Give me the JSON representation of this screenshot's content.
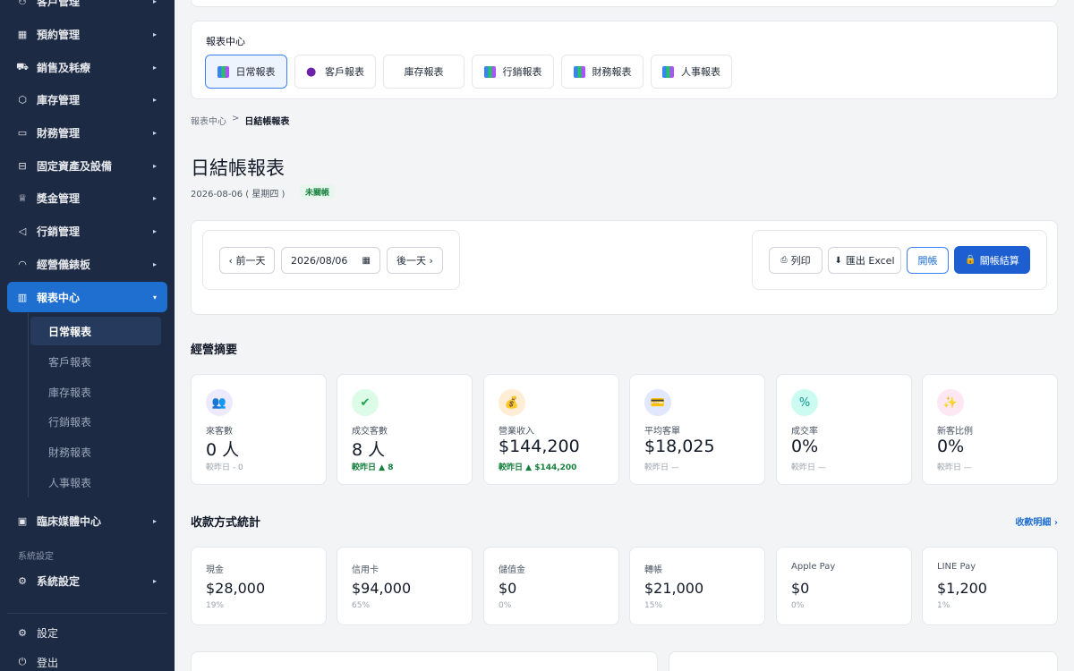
{
  "sidebar": {
    "items": [
      {
        "label": "客戶管理",
        "icon": "user-icon",
        "glyph": "⚇"
      },
      {
        "label": "預約管理",
        "icon": "calendar-icon",
        "glyph": "▦"
      },
      {
        "label": "銷售及耗療",
        "icon": "cart-icon",
        "glyph": "⛟"
      },
      {
        "label": "庫存管理",
        "icon": "box-icon",
        "glyph": "⬡"
      },
      {
        "label": "財務管理",
        "icon": "wallet-icon",
        "glyph": "▭"
      },
      {
        "label": "固定資產及設備",
        "icon": "briefcase-icon",
        "glyph": "⊟"
      },
      {
        "label": "獎金管理",
        "icon": "trophy-icon",
        "glyph": "♕"
      },
      {
        "label": "行銷管理",
        "icon": "megaphone-icon",
        "glyph": "◁"
      },
      {
        "label": "經營儀錶板",
        "icon": "gauge-icon",
        "glyph": "◠"
      },
      {
        "label": "報表中心",
        "icon": "bar-chart-icon",
        "glyph": "▥"
      }
    ],
    "sub_items": [
      "日常報表",
      "客戶報表",
      "庫存報表",
      "行銷報表",
      "財務報表",
      "人事報表"
    ],
    "media": {
      "label": "臨床媒體中心",
      "icon": "image-icon",
      "glyph": "▣"
    },
    "system_section": "系統設定",
    "system": {
      "label": "系統設定",
      "icon": "gear-icon",
      "glyph": "⚙"
    },
    "settings": {
      "label": "設定",
      "icon": "settings-icon",
      "glyph": "⚙"
    },
    "logout": {
      "label": "登出",
      "icon": "power-icon",
      "glyph": "⏻"
    }
  },
  "report_center": {
    "title": "報表中心",
    "tabs": [
      {
        "label": "日常報表"
      },
      {
        "label": "客戶報表"
      },
      {
        "label": "庫存報表"
      },
      {
        "label": "行銷報表"
      },
      {
        "label": "財務報表"
      },
      {
        "label": "人事報表"
      }
    ]
  },
  "breadcrumb": {
    "parent": "報表中心",
    "sep": ">",
    "current": "日結帳報表"
  },
  "page": {
    "title": "日結帳報表",
    "date_text": "2026-08-06 ( 星期四 )",
    "status": "未關帳"
  },
  "toolbar": {
    "prev": "‹ 前一天",
    "date_value": "2026/08/06",
    "next": "後一天 ›",
    "print": "列印",
    "export": "匯出 Excel",
    "open": "開帳",
    "close": "關帳結算"
  },
  "summary": {
    "title": "經營摘要",
    "cards": [
      {
        "label": "來客數",
        "value": "0 人",
        "cmp": "較昨日 - 0",
        "glyph": "👥"
      },
      {
        "label": "成交客數",
        "value": "8 人",
        "cmp": "較昨日 ▲ 8",
        "glyph": "✔"
      },
      {
        "label": "營業收入",
        "value": "$144,200",
        "cmp": "較昨日 ▲ $144,200",
        "glyph": "💰"
      },
      {
        "label": "平均客單",
        "value": "$18,025",
        "cmp": "較昨日 —",
        "glyph": "💳"
      },
      {
        "label": "成交率",
        "value": "0%",
        "cmp": "較昨日 —",
        "glyph": "%"
      },
      {
        "label": "新客比例",
        "value": "0%",
        "cmp": "較昨日 —",
        "glyph": "✨"
      }
    ]
  },
  "payments": {
    "title": "收款方式統計",
    "detail_link": "收款明細 ›",
    "cards": [
      {
        "label": "現金",
        "value": "$28,000",
        "pct": "19%"
      },
      {
        "label": "信用卡",
        "value": "$94,000",
        "pct": "65%"
      },
      {
        "label": "儲值金",
        "value": "$0",
        "pct": "0%"
      },
      {
        "label": "轉帳",
        "value": "$21,000",
        "pct": "15%"
      },
      {
        "label": "Apple Pay",
        "value": "$0",
        "pct": "0%"
      },
      {
        "label": "LINE Pay",
        "value": "$1,200",
        "pct": "1%"
      }
    ]
  },
  "colors": {
    "accent": "#1e6fd0",
    "sidebar_bg": "#1c2a44",
    "positive": "#15803d"
  }
}
